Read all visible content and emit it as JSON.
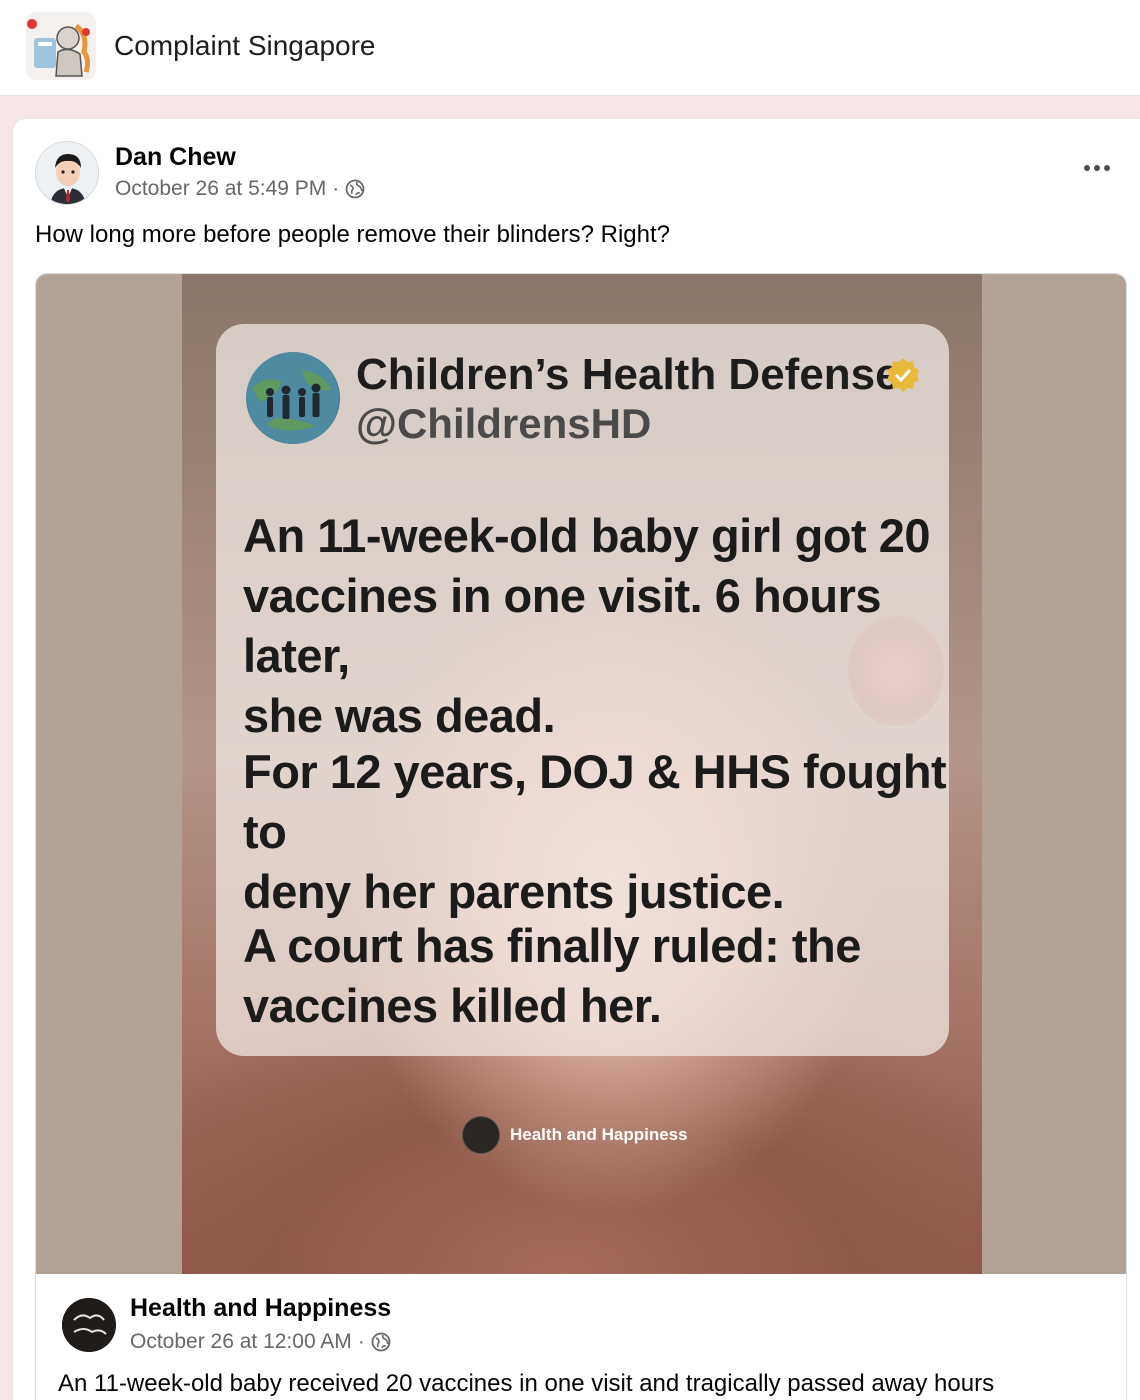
{
  "group": {
    "name": "Complaint Singapore",
    "icon": "group-illustration-icon"
  },
  "post": {
    "author": "Dan Chew",
    "timestamp": "October 26 at 5:49 PM",
    "separator": "·",
    "privacy_icon": "globe-icon",
    "more_icon": "more-options-icon",
    "text": "How long more before people remove their blinders? Right?"
  },
  "shared_image": {
    "account_name": "Children’s Health Defense",
    "account_handle": "@ChildrensHD",
    "verified_icon": "verified-badge-icon",
    "paragraphs": [
      {
        "lines": [
          "An 11-week-old baby girl got 20",
          "vaccines in one visit. 6 hours later,",
          "she was dead."
        ]
      },
      {
        "lines": [
          "For 12 years, DOJ & HHS fought to",
          "deny her parents justice."
        ]
      },
      {
        "lines": [
          "A court has finally ruled: the",
          "vaccines killed her."
        ]
      }
    ],
    "watermark": "Health and Happiness"
  },
  "shared_post": {
    "author": "Health and Happiness",
    "timestamp": "October 26 at 12:00 AM",
    "separator": "·",
    "privacy_icon": "globe-icon",
    "text": "An 11-week-old baby received 20 vaccines in one visit and tragically passed away hours"
  },
  "colors": {
    "page_bg": "#f7e6e8",
    "meta_text": "#65676b",
    "verified": "#e8b93a"
  }
}
